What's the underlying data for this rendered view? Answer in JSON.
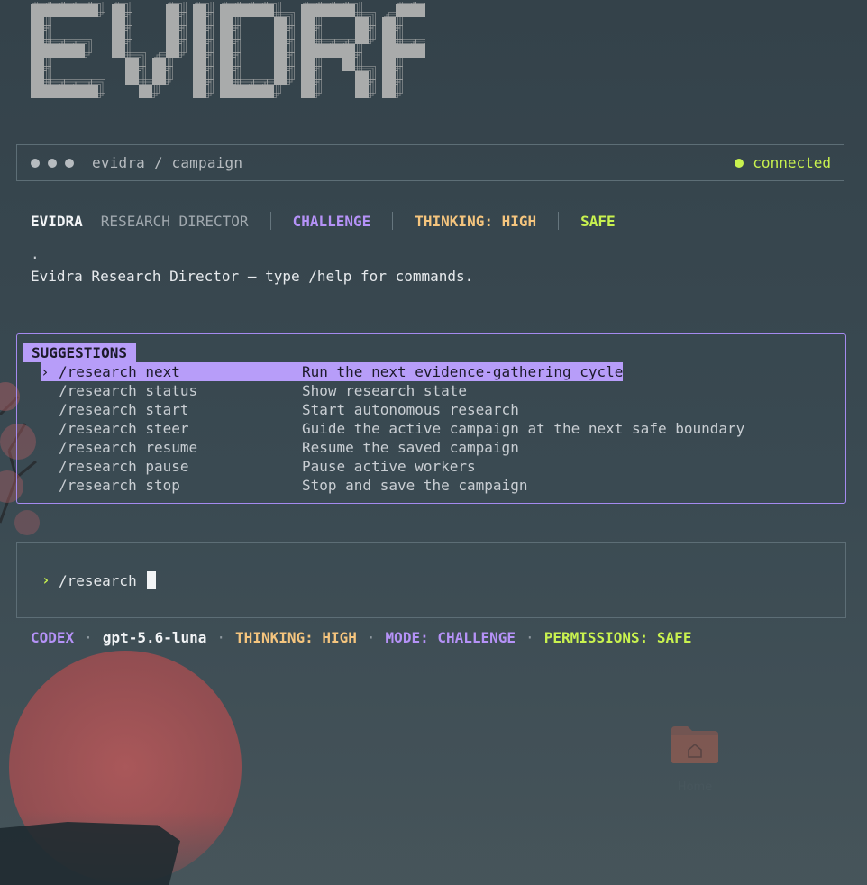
{
  "banner": {
    "text": "EVIDRA"
  },
  "titlebar": {
    "path": "evidra / campaign",
    "status": "connected"
  },
  "header": {
    "brand": "EVIDRA",
    "role": "RESEARCH DIRECTOR",
    "mode": "CHALLENGE",
    "thinking": "THINKING: HIGH",
    "safety": "SAFE"
  },
  "transcript": {
    "dot": ".",
    "welcome": "Evidra Research Director — type /help for commands."
  },
  "suggestions": {
    "title": "SUGGESTIONS",
    "selected_marker": "›",
    "items": [
      {
        "cmd": "/research next",
        "desc": "Run the next evidence-gathering cycle"
      },
      {
        "cmd": "/research status",
        "desc": "Show research state"
      },
      {
        "cmd": "/research start",
        "desc": "Start autonomous research"
      },
      {
        "cmd": "/research steer",
        "desc": "Guide the active campaign at the next safe boundary"
      },
      {
        "cmd": "/research resume",
        "desc": "Resume the saved campaign"
      },
      {
        "cmd": "/research pause",
        "desc": "Pause active workers"
      },
      {
        "cmd": "/research stop",
        "desc": "Stop and save the campaign"
      }
    ]
  },
  "input": {
    "prompt": "›",
    "value": "/research "
  },
  "footer": {
    "provider": "CODEX",
    "separator": "·",
    "model": "gpt-5.6-luna",
    "thinking": "THINKING: HIGH",
    "mode": "MODE: CHALLENGE",
    "permissions": "PERMISSIONS: SAFE"
  },
  "desktop": {
    "icon_label": "Home"
  },
  "colors": {
    "accent_purple": "#b79df9",
    "accent_green": "#c9f24f",
    "accent_orange": "#f5c57e",
    "banner_gray": "#a9abab"
  }
}
